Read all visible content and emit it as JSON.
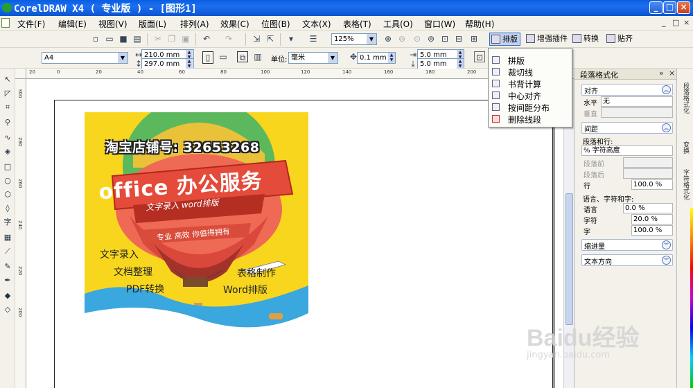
{
  "window": {
    "title": "CorelDRAW X4 ( 专业版 ) - [图形1]",
    "controls": [
      "_",
      "□",
      "×"
    ]
  },
  "menu": {
    "items": [
      "文件(F)",
      "编辑(E)",
      "视图(V)",
      "版面(L)",
      "排列(A)",
      "效果(C)",
      "位图(B)",
      "文本(X)",
      "表格(T)",
      "工具(O)",
      "窗口(W)",
      "帮助(H)"
    ],
    "mdi_controls": [
      "_",
      "□",
      "×"
    ]
  },
  "standard_toolbar": {
    "zoom": "125%",
    "plugins": [
      "排版",
      "增强插件",
      "转换",
      "贴齐"
    ]
  },
  "property_bar": {
    "page_size": "A4",
    "width": "210.0 mm",
    "height": "297.0 mm",
    "unit_label": "单位:",
    "unit": "毫米",
    "nudge": "0.1 mm",
    "dup_x": "5.0 mm",
    "dup_y": "5.0 mm"
  },
  "rulers": {
    "horizontal_ticks": [
      "20",
      "0",
      "20",
      "40",
      "60",
      "80",
      "100",
      "120",
      "140",
      "160",
      "180",
      "200",
      "220"
    ],
    "vertical_ticks": [
      "300",
      "280",
      "260",
      "240",
      "220",
      "200"
    ]
  },
  "dropdown": {
    "items": [
      "拼版",
      "裁切线",
      "书背计算",
      "中心对齐",
      "按间距分布",
      "删除线段"
    ]
  },
  "poster": {
    "shop": "淘宝店铺号: 32653268",
    "main": "office 办公服务",
    "sub": "文字录入 word排版",
    "slogan": "专业 高效 你值得拥有",
    "services": [
      "文字录入",
      "文档整理",
      "PDF转换",
      "表格制作",
      "Word排版"
    ]
  },
  "docker": {
    "title": "段落格式化",
    "align": {
      "section": "对齐",
      "horizontal_label": "水平",
      "horizontal_value": "无",
      "vertical_label": "垂直"
    },
    "spacing": {
      "section": "间距",
      "para_line_label": "段落和行:",
      "mode": "% 字符高度",
      "before_label": "段落前",
      "after_label": "段落后",
      "line_label": "行",
      "line_value": "100.0 %",
      "lang_label": "语言、字符和字:",
      "language_label": "语言",
      "language_value": "0.0 %",
      "char_label": "字符",
      "char_value": "20.0 %",
      "word_label": "字",
      "word_value": "100.0 %"
    },
    "indent": "缩进量",
    "text_direction": "文本方向"
  },
  "right_tabs": [
    "段落格式化",
    "变换",
    "字符格式化"
  ],
  "watermark": {
    "main": "Baidu经验",
    "sub": "jingyan.baidu.com"
  }
}
